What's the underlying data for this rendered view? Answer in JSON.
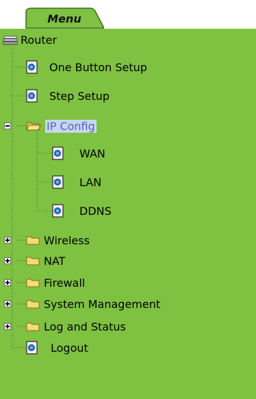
{
  "menu_tab": {
    "label": "Menu"
  },
  "tree": {
    "root": {
      "label": "Router",
      "icon": "router-icon"
    },
    "items": [
      {
        "label": "One Button Setup",
        "icon": "page-icon"
      },
      {
        "label": "Step Setup",
        "icon": "page-icon"
      },
      {
        "label": "IP Config",
        "icon": "folder-open-icon",
        "expanded": true,
        "selected": true,
        "children": [
          {
            "label": "WAN",
            "icon": "page-icon"
          },
          {
            "label": "LAN",
            "icon": "page-icon"
          },
          {
            "label": "DDNS",
            "icon": "page-icon"
          }
        ]
      },
      {
        "label": "Wireless",
        "icon": "folder-closed-icon",
        "expanded": false
      },
      {
        "label": "NAT",
        "icon": "folder-closed-icon",
        "expanded": false
      },
      {
        "label": "Firewall",
        "icon": "folder-closed-icon",
        "expanded": false
      },
      {
        "label": "System Management",
        "icon": "folder-closed-icon",
        "expanded": false
      },
      {
        "label": "Log and Status",
        "icon": "folder-closed-icon",
        "expanded": false
      },
      {
        "label": "Logout",
        "icon": "page-icon"
      }
    ]
  },
  "colors": {
    "panel_bg": "#7fc141",
    "tab_fill": "#7fc141",
    "selected_bg": "#c9d6ef",
    "selected_text": "#4a66c6"
  }
}
